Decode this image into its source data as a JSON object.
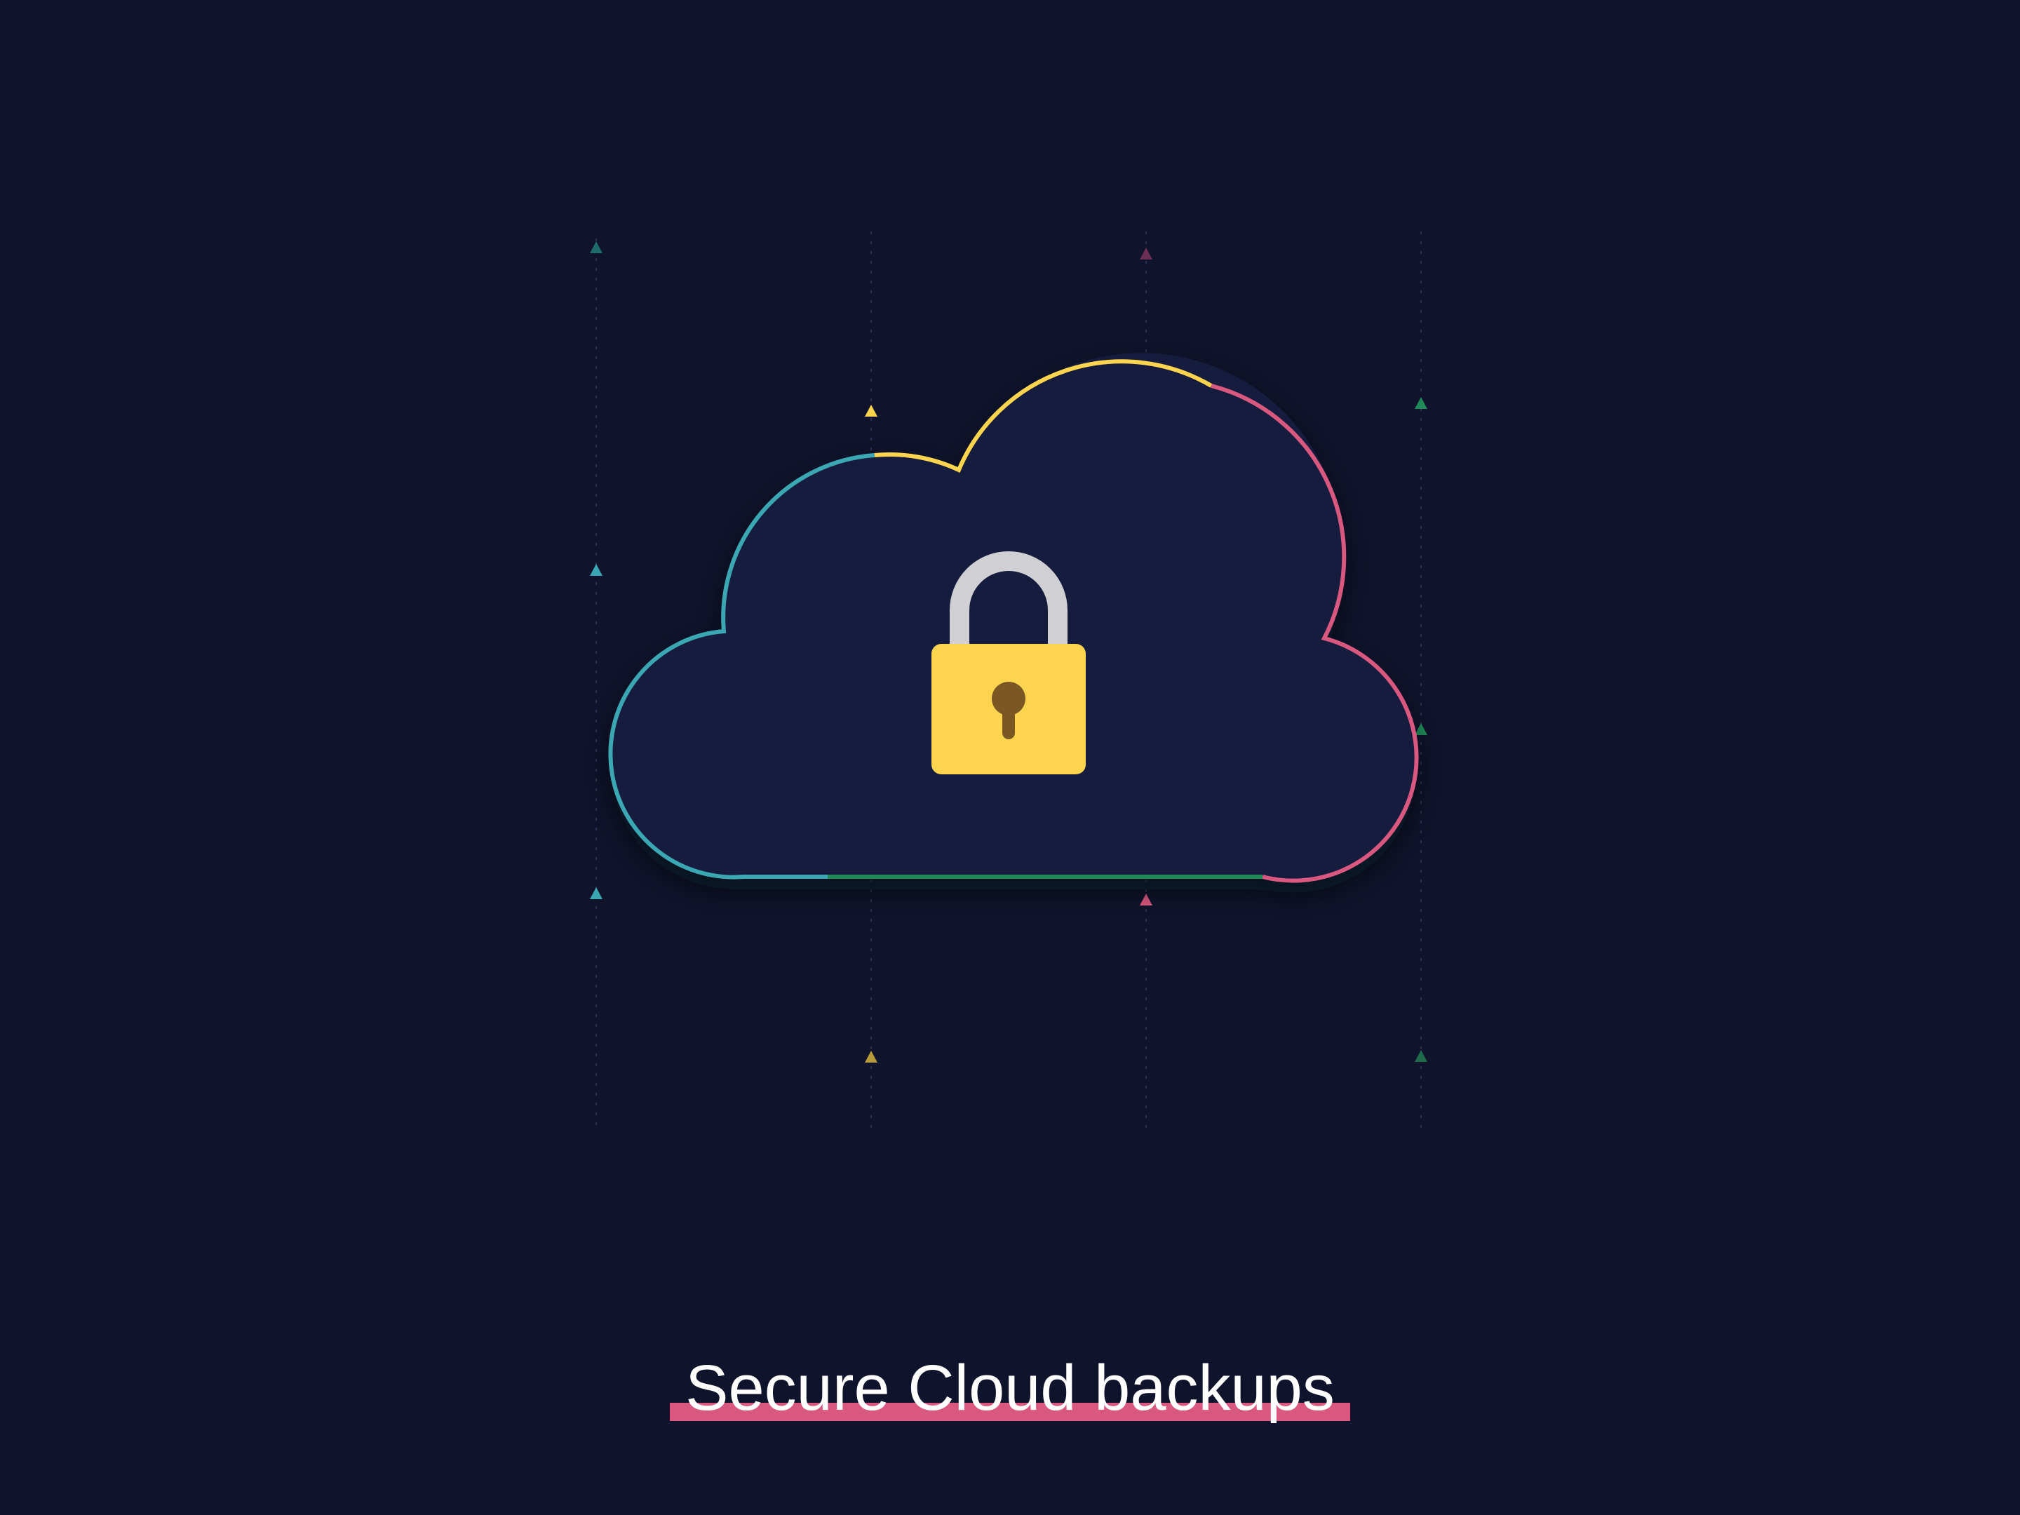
{
  "title": "Secure Cloud backups",
  "colors": {
    "background": "#0f132b",
    "cloud_fill": "#141d3d",
    "teal": "#3aa7b3",
    "yellow": "#ffd54f",
    "pink": "#d9587f",
    "green": "#1f8a57",
    "lock_body": "#ffd54f",
    "lock_shackle": "#cfcfd4",
    "keyhole": "#7a5723"
  },
  "icons": {
    "cloud": "cloud-icon",
    "lock": "padlock-icon",
    "arrow": "arrow-up-icon"
  }
}
